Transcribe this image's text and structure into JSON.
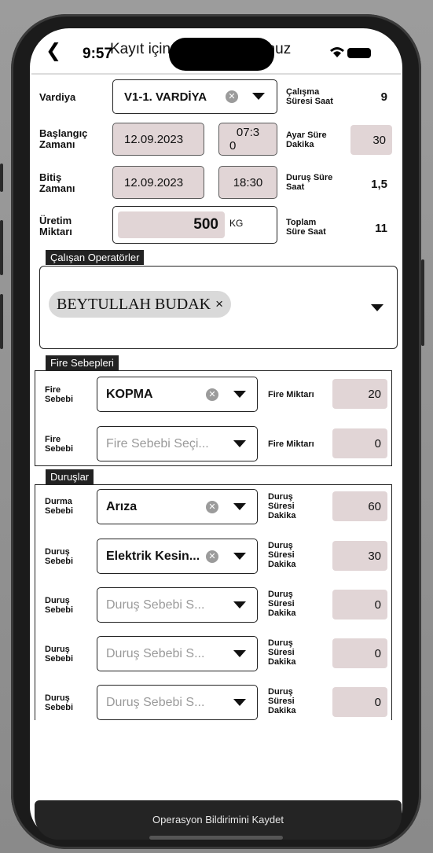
{
  "status": {
    "time": "9:57"
  },
  "header": {
    "title": "Kayıt için formu doldurunuz"
  },
  "form": {
    "shift": {
      "label": "Vardiya",
      "value": "V1-1. VARDİYA"
    },
    "work_duration": {
      "label_line1": "Çalışma",
      "label_line2": "Süresi Saat",
      "value": "9"
    },
    "start": {
      "label_line1": "Başlangıç",
      "label_line2": "Zamanı",
      "date": "12.09.2023",
      "time_line1": "07:3",
      "time_line2": "0"
    },
    "setup_minutes": {
      "label_line1": "Ayar Süre",
      "label_line2": "Dakika",
      "value": "30"
    },
    "end": {
      "label_line1": "Bitiş",
      "label_line2": "Zamanı",
      "date": "12.09.2023",
      "time": "18:30"
    },
    "stop_hours": {
      "label_line1": "Duruş Süre",
      "label_line2": "Saat",
      "value": "1,5"
    },
    "production": {
      "label_line1": "Üretim",
      "label_line2": "Miktarı",
      "value": "500",
      "unit": "KG"
    },
    "total_hours": {
      "label_line1": "Toplam",
      "label_line2": "Süre Saat",
      "value": "11"
    }
  },
  "operators": {
    "section_title": "Çalışan Operatörler",
    "chips": [
      {
        "name": "BEYTULLAH BUDAK",
        "remove": "×"
      }
    ]
  },
  "scrap": {
    "section_title": "Fire Sebepleri",
    "rows": [
      {
        "label_line1": "Fire",
        "label_line2": "Sebebi",
        "value": "KOPMA",
        "placeholder": "",
        "qty_label": "Fire Miktarı",
        "qty": "20"
      },
      {
        "label_line1": "Fire",
        "label_line2": "Sebebi",
        "value": "",
        "placeholder": "Fire Sebebi Seçi...",
        "qty_label": "Fire Miktarı",
        "qty": "0"
      }
    ]
  },
  "stops": {
    "section_title": "Duruşlar",
    "rows": [
      {
        "label_line1": "Durma",
        "label_line2": "Sebebi",
        "value": "Arıza",
        "placeholder": "",
        "dur_line1": "Duruş",
        "dur_line2": "Süresi",
        "dur_line3": "Dakika",
        "qty": "60"
      },
      {
        "label_line1": "Duruş",
        "label_line2": "Sebebi",
        "value": "Elektrik Kesin...",
        "placeholder": "",
        "dur_line1": "Duruş",
        "dur_line2": "Süresi",
        "dur_line3": "Dakika",
        "qty": "30"
      },
      {
        "label_line1": "Duruş",
        "label_line2": "Sebebi",
        "value": "",
        "placeholder": "Duruş Sebebi S...",
        "dur_line1": "Duruş",
        "dur_line2": "Süresi",
        "dur_line3": "Dakika",
        "qty": "0"
      },
      {
        "label_line1": "Duruş",
        "label_line2": "Sebebi",
        "value": "",
        "placeholder": "Duruş Sebebi S...",
        "dur_line1": "Duruş",
        "dur_line2": "Süresi",
        "dur_line3": "Dakika",
        "qty": "0"
      },
      {
        "label_line1": "Duruş",
        "label_line2": "Sebebi",
        "value": "",
        "placeholder": "Duruş Sebebi S...",
        "dur_line1": "Duruş",
        "dur_line2": "Süresi",
        "dur_line3": "Dakika",
        "qty": "0"
      }
    ]
  },
  "footer": {
    "save_label": "Operasyon Bildirimini Kaydet"
  },
  "icons": [
    "back-chevron-icon",
    "wifi-icon",
    "battery-icon",
    "clear-icon",
    "caret-down-icon",
    "chip-remove-icon"
  ],
  "colors": {
    "field_fill": "#e1d5d6",
    "section_tag_bg": "#222222",
    "save_bar_bg": "#242424"
  }
}
